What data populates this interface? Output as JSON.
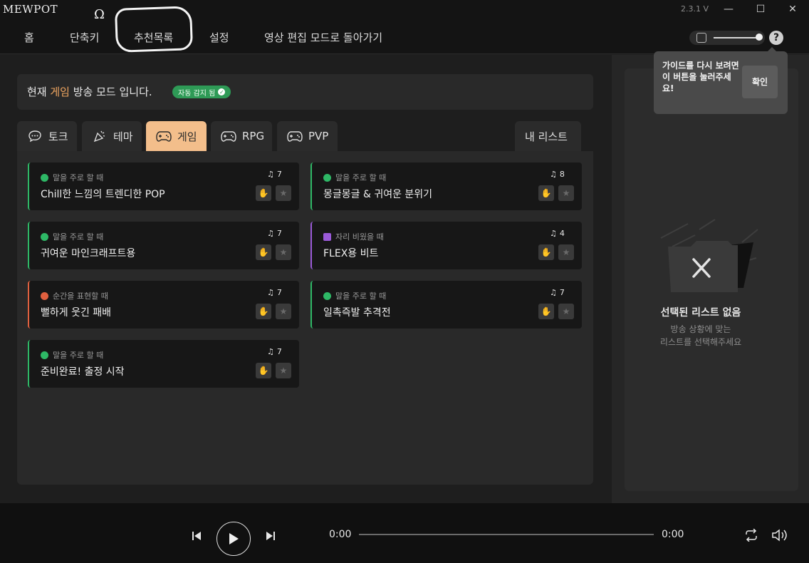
{
  "app": {
    "logo": "MEWPOT",
    "version": "2.3.1 V"
  },
  "window_controls": {
    "minimize": "—",
    "maximize": "☐",
    "close": "✕"
  },
  "annotation": {
    "scribble": "Ω"
  },
  "nav": {
    "items": [
      {
        "label": "홈"
      },
      {
        "label": "단축키"
      },
      {
        "label": "추천목록"
      },
      {
        "label": "설정"
      },
      {
        "label": "영상 편집 모드로 돌아가기"
      }
    ],
    "help": "?"
  },
  "tooltip": {
    "text": "가이드를 다시 보려면 이 버튼을 눌러주세요!",
    "button": "확인"
  },
  "mode": {
    "prefix": "현재 ",
    "highlight": "게임",
    "suffix": " 방송 모드 입니다.",
    "badge": "자동 감지 됨",
    "badge_check": "✓"
  },
  "tabs": [
    {
      "label": "토크",
      "icon": "chat-icon"
    },
    {
      "label": "테마",
      "icon": "party-popper-icon"
    },
    {
      "label": "게임",
      "icon": "gamepad-icon",
      "active": true
    },
    {
      "label": "RPG",
      "icon": "gamepad-icon"
    },
    {
      "label": "PVP",
      "icon": "gamepad-icon"
    }
  ],
  "my_list_tab": "내 리스트",
  "cards": [
    {
      "tag": "말을 주로 할 때",
      "title": "Chill한 느낌의 트렌디한 POP",
      "count": "7",
      "color": "#2eb866"
    },
    {
      "tag": "말을 주로 할 때",
      "title": "몽글몽글 & 귀여운 분위기",
      "count": "8",
      "color": "#2eb866"
    },
    {
      "tag": "말을 주로 할 때",
      "title": "귀여운 마인크래프트용",
      "count": "7",
      "color": "#2eb866"
    },
    {
      "tag": "자리 비웠을 때",
      "title": "FLEX용 비트",
      "count": "4",
      "color": "#9a5ad8"
    },
    {
      "tag": "순간을 표현할 때",
      "title": "뻘하게 웃긴 패배",
      "count": "7",
      "color": "#e0603f"
    },
    {
      "tag": "말을 주로 할 때",
      "title": "일촉즉발 추격전",
      "count": "7",
      "color": "#2eb866"
    },
    {
      "tag": "말을 주로 할 때",
      "title": "준비완료! 출정 시작",
      "count": "7",
      "color": "#2eb866"
    }
  ],
  "music_glyph": "♫",
  "card_buttons": {
    "add": "✋",
    "favorite": "★"
  },
  "empty_state": {
    "title": "선택된 리스트 없음",
    "subtitle_1": "방송 상황에 맞는",
    "subtitle_2": "리스트를 선택해주세요",
    "close_glyph": "✕"
  },
  "player": {
    "current_time": "0:00",
    "total_time": "0:00",
    "play": "▶",
    "prev": "⏮",
    "next": "⏭",
    "repeat": "⟳",
    "volume": "🔈"
  }
}
